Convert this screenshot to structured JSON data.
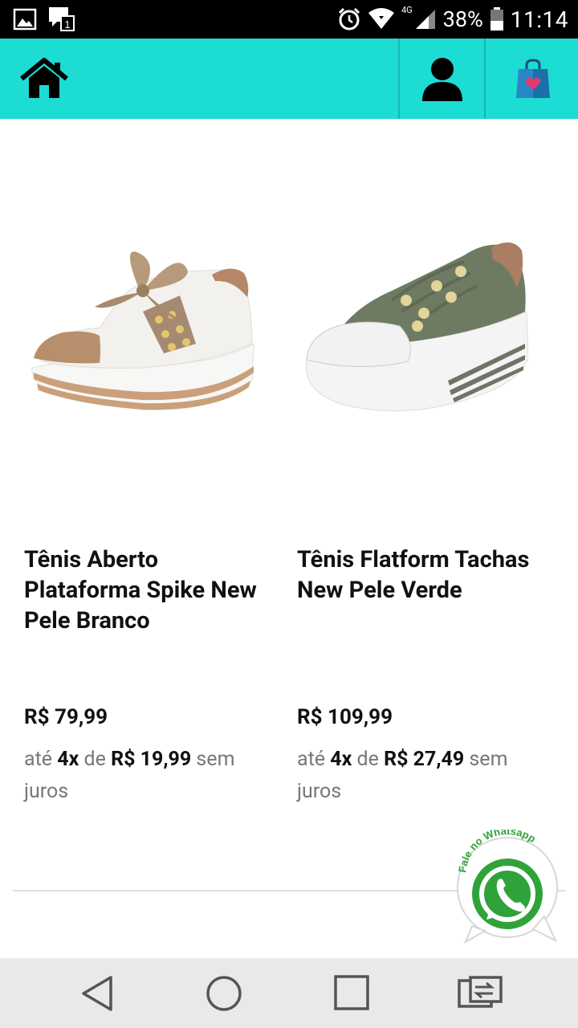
{
  "status_bar": {
    "network": "4G",
    "battery": "38%",
    "time": "11:14",
    "icons": [
      "gallery-icon",
      "chat-notification-icon",
      "alarm-icon",
      "wifi-icon",
      "signal-icon",
      "battery-icon"
    ]
  },
  "app_bar": {
    "background": "#1cdcd4",
    "icons": [
      "home-icon",
      "user-icon",
      "shopping-bag-icon"
    ]
  },
  "products": [
    {
      "name": "Tênis Aberto Plataforma Spike New Pele Branco",
      "price": "R$ 79,99",
      "inst_prefix": "até",
      "inst_count": "4x",
      "inst_mid": "de",
      "inst_value": "R$ 19,99",
      "inst_suffix": "sem juros"
    },
    {
      "name": "Tênis Flatform Tachas New Pele Verde",
      "price": "R$ 109,99",
      "inst_prefix": "até",
      "inst_count": "4x",
      "inst_mid": "de",
      "inst_value": "R$ 27,49",
      "inst_suffix": "sem juros"
    }
  ],
  "whatsapp": {
    "label": "Fale no Whatsapp",
    "color": "#2fa33a"
  },
  "nav_bar": {
    "icons": [
      "back-icon",
      "home-circle-icon",
      "recents-icon",
      "switch-app-icon"
    ]
  }
}
